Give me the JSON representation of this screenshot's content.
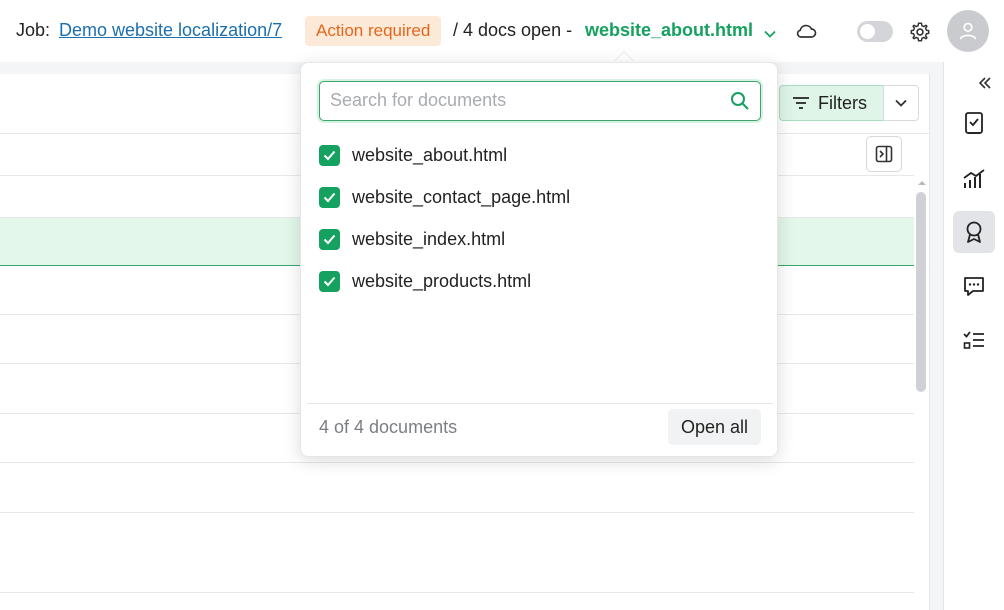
{
  "header": {
    "job_prefix": "Job:",
    "job_link": "Demo website localization/7",
    "status_badge": "Action required",
    "docs_open": "/ 4 docs open -",
    "current_doc": "website_about.html"
  },
  "toolbar": {
    "filters_label": "Filters"
  },
  "dropdown": {
    "search_placeholder": "Search for documents",
    "documents": [
      {
        "label": "website_about.html",
        "checked": true
      },
      {
        "label": "website_contact_page.html",
        "checked": true
      },
      {
        "label": "website_index.html",
        "checked": true
      },
      {
        "label": "website_products.html",
        "checked": true
      }
    ],
    "count_text": "4 of 4 documents",
    "open_all_label": "Open all"
  },
  "sidebar": {
    "icons": [
      "task-check-icon",
      "analytics-icon",
      "qa-ribbon-icon",
      "comments-icon",
      "checklist-icon"
    ],
    "active_index": 2
  },
  "colors": {
    "accent": "#15a160",
    "badge_text": "#e5671c",
    "badge_bg": "#fde9d7",
    "link": "#1a6fb0"
  }
}
